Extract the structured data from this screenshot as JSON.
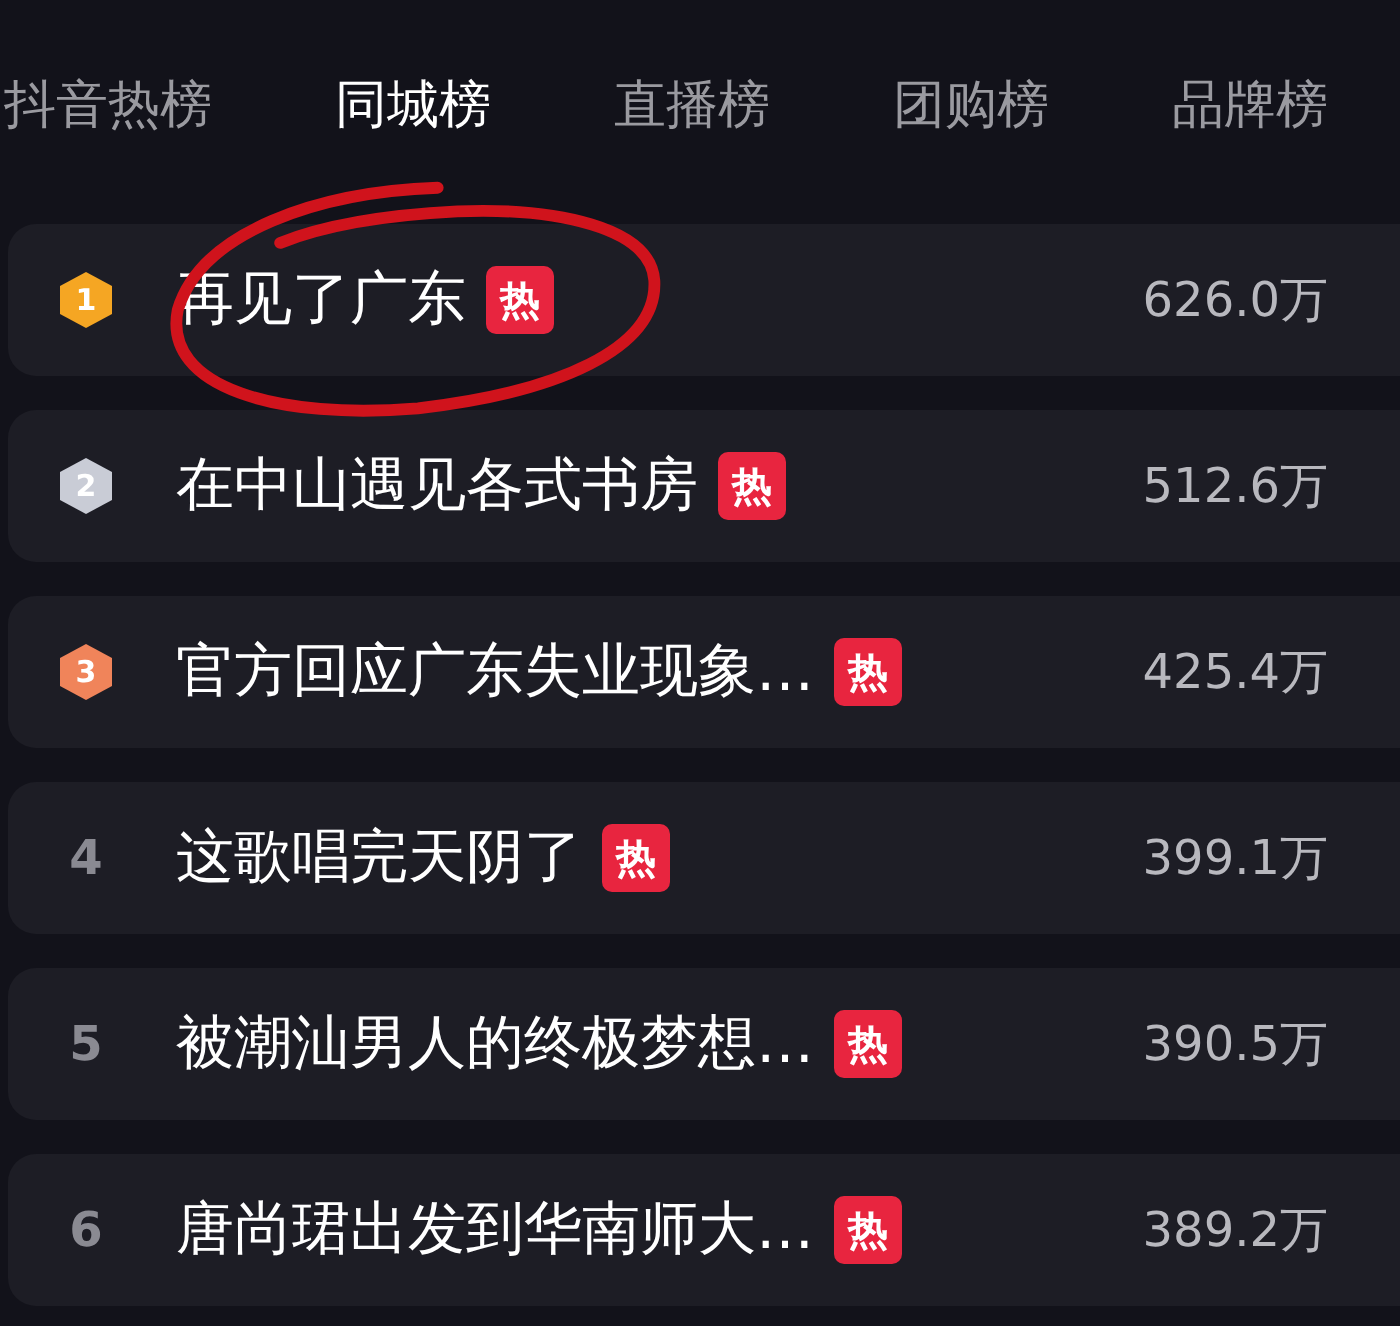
{
  "tabs": [
    {
      "label": "抖音热榜",
      "selected": false
    },
    {
      "label": "同城榜",
      "selected": true
    },
    {
      "label": "直播榜",
      "selected": false
    },
    {
      "label": "团购榜",
      "selected": false
    },
    {
      "label": "品牌榜",
      "selected": false
    }
  ],
  "rows": [
    {
      "kind": "medal",
      "rank": "1",
      "color": "#f5a623",
      "title": "再见了广东",
      "tag": "热",
      "count": "626.0万"
    },
    {
      "kind": "medal",
      "rank": "2",
      "color": "#c9ccd6",
      "title": "在中山遇见各式书房",
      "tag": "热",
      "count": "512.6万"
    },
    {
      "kind": "medal",
      "rank": "3",
      "color": "#f0845a",
      "title": "官方回应广东失业现象…",
      "tag": "热",
      "count": "425.4万"
    },
    {
      "kind": "plain",
      "rank": "4",
      "title": "这歌唱完天阴了",
      "tag": "热",
      "count": "399.1万"
    },
    {
      "kind": "plain",
      "rank": "5",
      "title": "被潮汕男人的终极梦想…",
      "tag": "热",
      "count": "390.5万"
    },
    {
      "kind": "plain",
      "rank": "6",
      "title": "唐尚珺出发到华南师大…",
      "tag": "热",
      "count": "389.2万"
    }
  ],
  "annotation": {
    "kind": "circle"
  }
}
